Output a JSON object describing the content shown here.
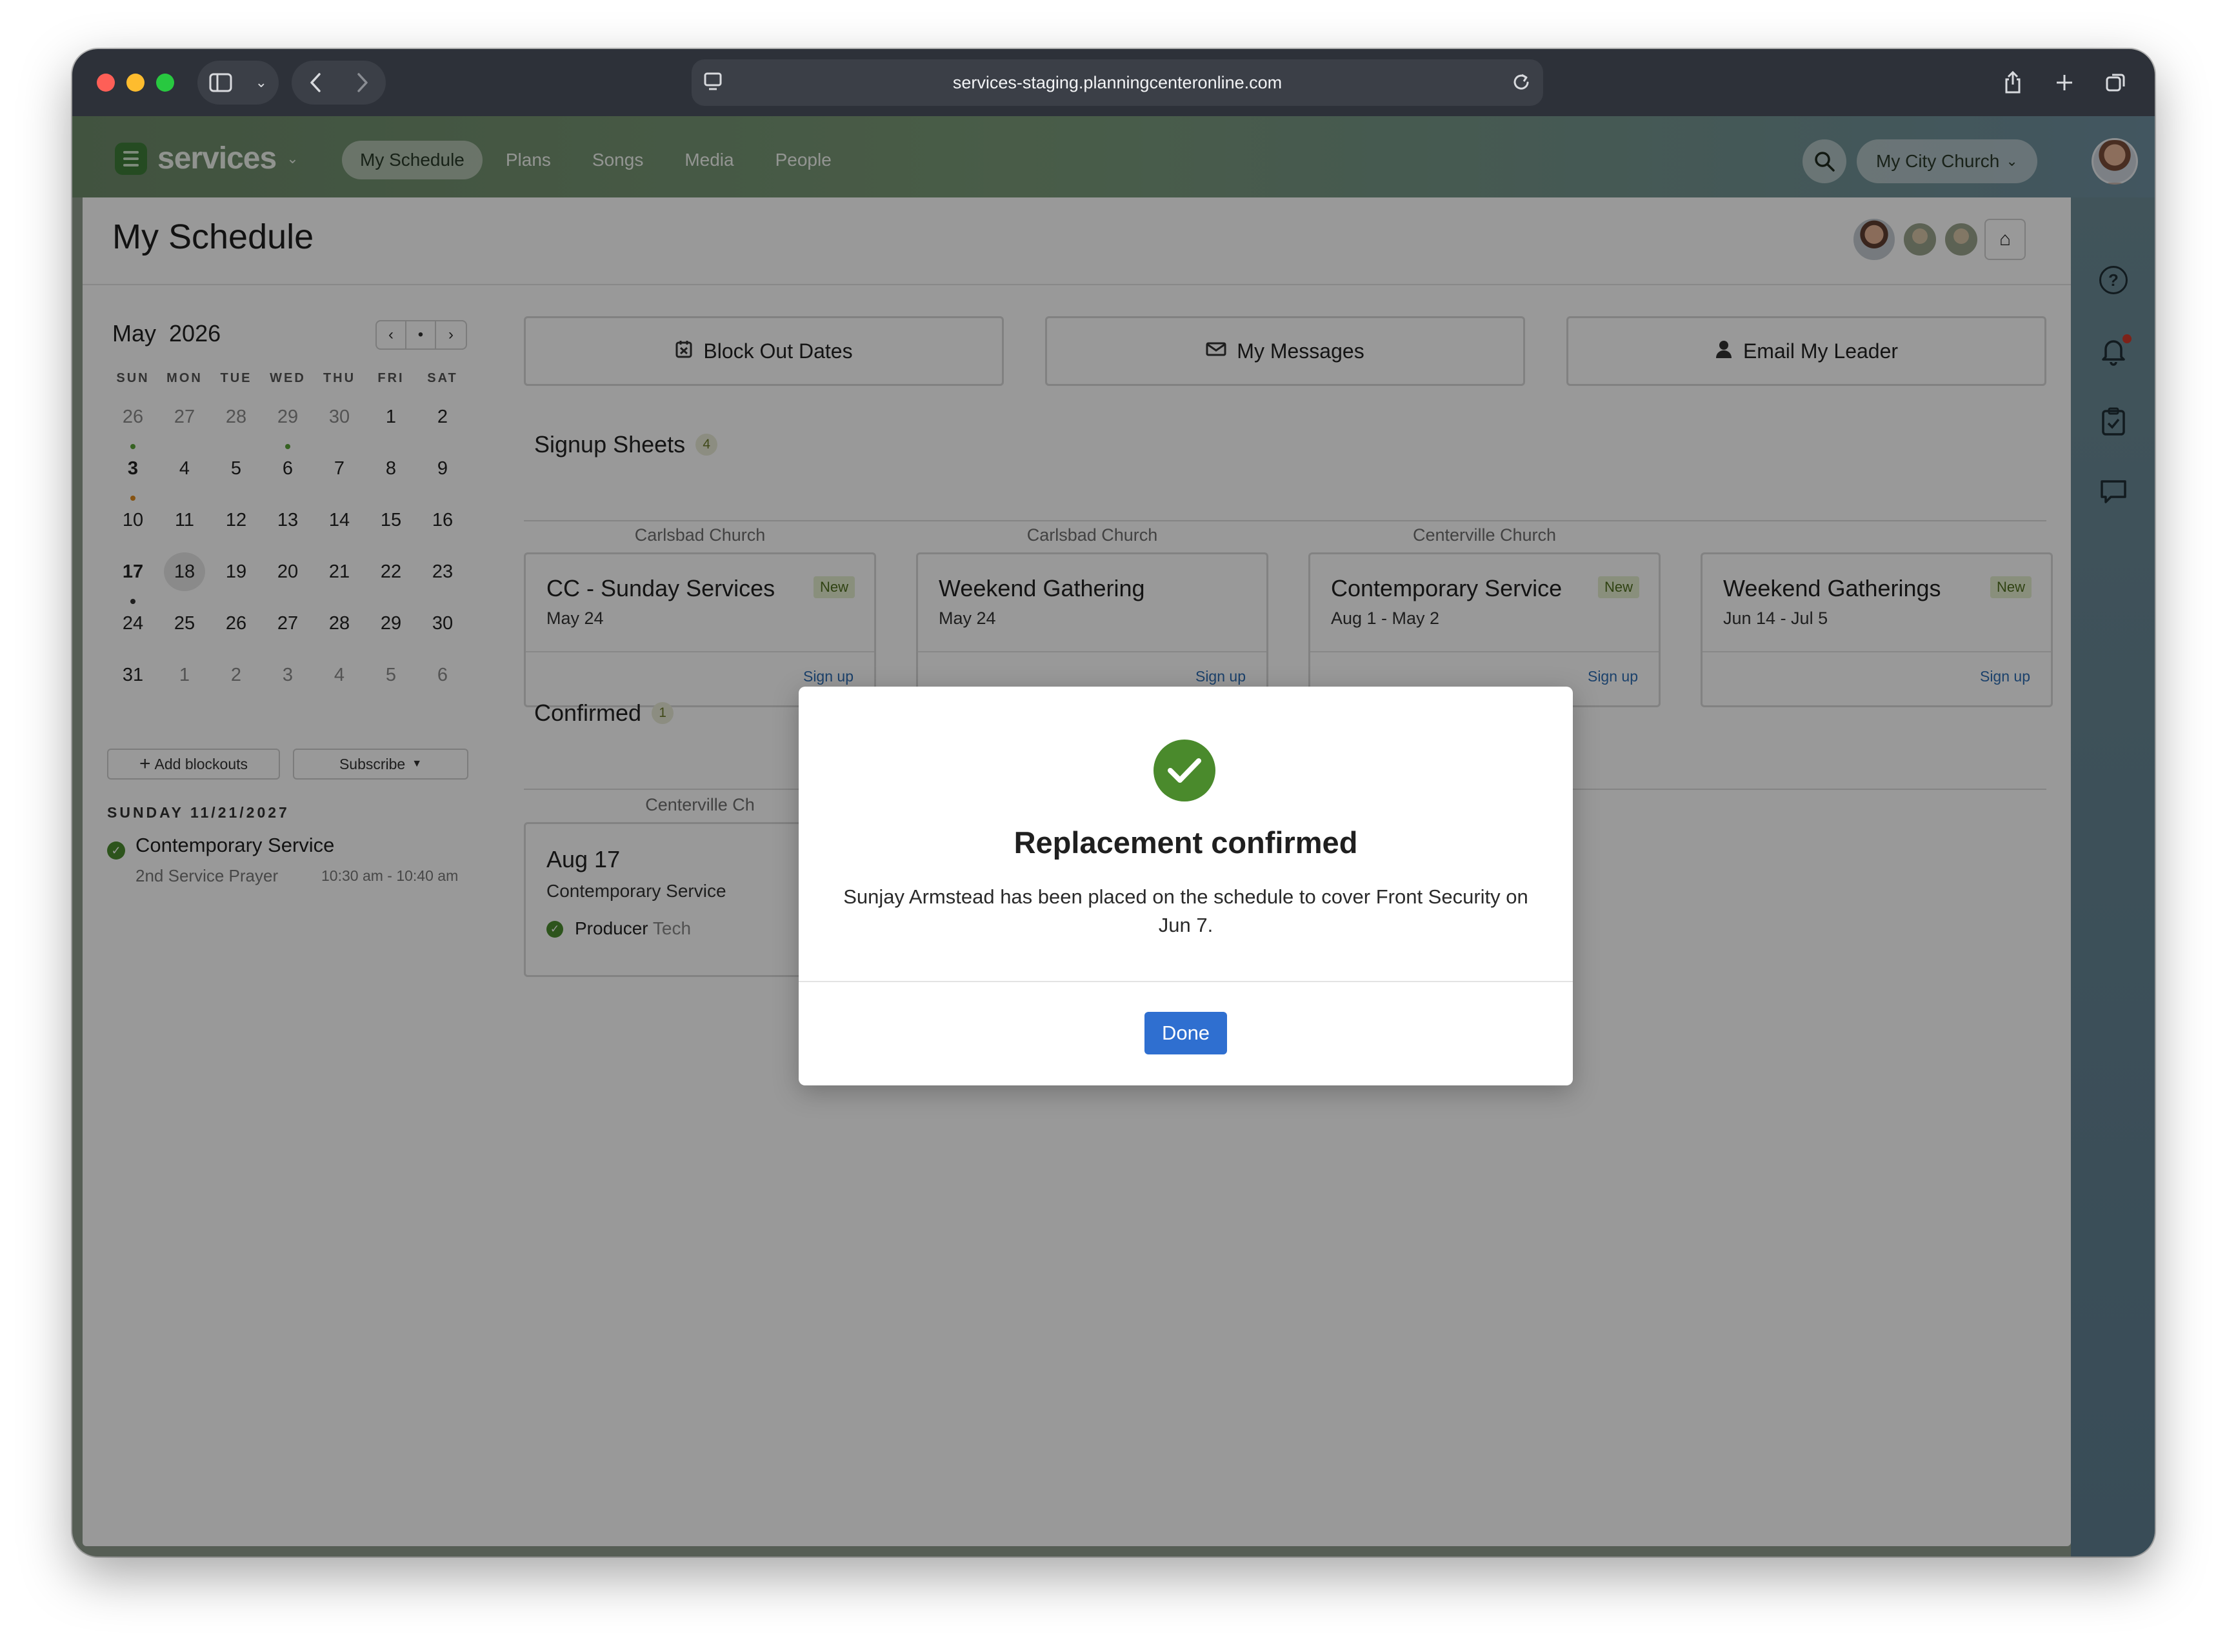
{
  "browser": {
    "url": "services-staging.planningcenteronline.com"
  },
  "app": {
    "brand": "services",
    "nav": [
      "My Schedule",
      "Plans",
      "Songs",
      "Media",
      "People"
    ],
    "church": "My City Church"
  },
  "page": {
    "title": "My Schedule"
  },
  "calendar": {
    "month": "May",
    "year": "2026",
    "dow": [
      "SUN",
      "MON",
      "TUE",
      "WED",
      "THU",
      "FRI",
      "SAT"
    ],
    "weeks": [
      [
        "26",
        "27",
        "28",
        "29",
        "30",
        "1",
        "2"
      ],
      [
        "3",
        "4",
        "5",
        "6",
        "7",
        "8",
        "9"
      ],
      [
        "10",
        "11",
        "12",
        "13",
        "14",
        "15",
        "16"
      ],
      [
        "17",
        "18",
        "19",
        "20",
        "21",
        "22",
        "23"
      ],
      [
        "24",
        "25",
        "26",
        "27",
        "28",
        "29",
        "30"
      ],
      [
        "31",
        "1",
        "2",
        "3",
        "4",
        "5",
        "6"
      ]
    ],
    "add_blockouts": "Add blockouts",
    "subscribe": "Subscribe"
  },
  "upcoming": {
    "date": "SUNDAY 11/21/2027",
    "title": "Contemporary Service",
    "subtitle": "2nd Service Prayer",
    "time": "10:30 am - 10:40 am"
  },
  "actions": {
    "block_out": "Block Out Dates",
    "messages": "My Messages",
    "email_leader": "Email My Leader"
  },
  "signup": {
    "title": "Signup Sheets",
    "count": "4",
    "new_label": "New",
    "signup_label": "Sign up",
    "sheets": [
      {
        "org": "Carlsbad Church",
        "title": "CC - Sunday Services",
        "date": "May 24"
      },
      {
        "org": "Carlsbad Church",
        "title": "Weekend Gathering",
        "date": "May 24"
      },
      {
        "org": "Centerville Church",
        "title": "Contemporary Service",
        "date": "Aug 1 - May 2"
      },
      {
        "org": "",
        "title": "Weekend Gatherings",
        "date": "Jun 14 - Jul 5"
      }
    ]
  },
  "confirmed": {
    "title": "Confirmed",
    "count": "1",
    "org": "Centerville Ch",
    "date": "Aug 17",
    "service": "Contemporary Service",
    "role": "Producer",
    "team": "Tech"
  },
  "modal": {
    "title": "Replacement confirmed",
    "body": "Sunjay Armstead has been placed on the schedule to cover Front Security on Jun 7.",
    "done": "Done"
  },
  "colors": {
    "accent_green": "#4a8a2c",
    "primary_blue": "#2f6fd0",
    "chrome_dark": "#2d3139"
  }
}
